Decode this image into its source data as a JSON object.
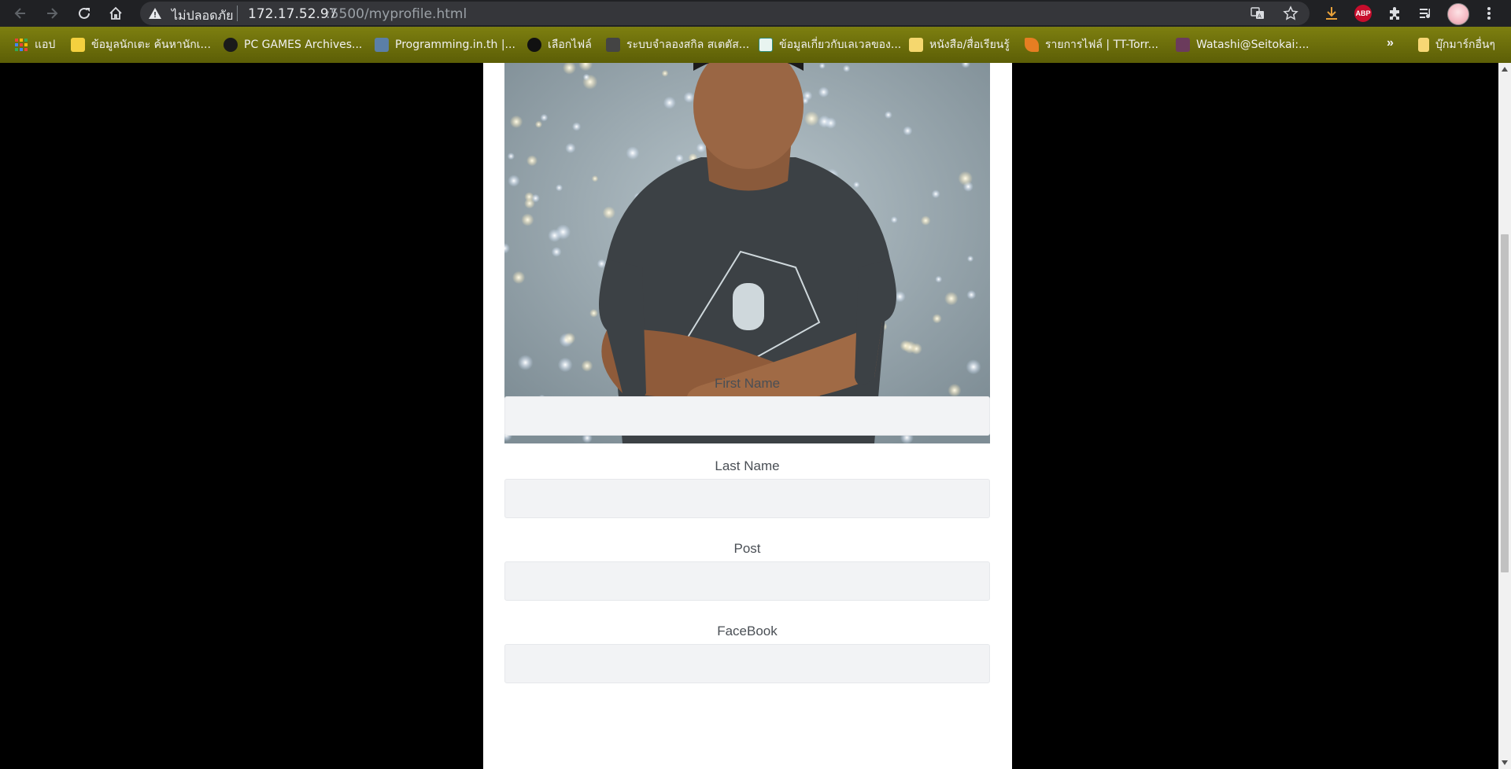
{
  "browser": {
    "security_label": "ไม่ปลอดภัย",
    "url_host": "172.17.52.97",
    "url_path": ":5500/myprofile.html",
    "abp_label": "ABP"
  },
  "bookmarks": {
    "apps_label": "แอป",
    "items": [
      {
        "label": "ข้อมูลนักเตะ ค้นหานักเ..."
      },
      {
        "label": "PC GAMES Archives..."
      },
      {
        "label": "Programming.in.th |..."
      },
      {
        "label": "เลือกไฟล์"
      },
      {
        "label": "ระบบจำลองสกิล สเตตัส..."
      },
      {
        "label": "ข้อมูลเกี่ยวกับเลเวลของ..."
      },
      {
        "label": "หนังสือ/สื่อเรียนรู้"
      },
      {
        "label": "รายการไฟล์ | TT-Torr..."
      },
      {
        "label": "Watashi@Seitokai:..."
      }
    ],
    "more_label": "»",
    "other_label": "บุ๊กมาร์กอื่นๆ"
  },
  "form": {
    "first_name_label": "First Name",
    "first_name_value": "",
    "last_name_label": "Last Name",
    "last_name_value": "",
    "post_label": "Post",
    "post_value": "",
    "facebook_label": "FaceBook",
    "facebook_value": ""
  },
  "colors": {
    "page_bg": "#000000",
    "card_bg": "#ffffff",
    "input_bg": "#f2f3f5",
    "bookmark_bar": "#6d6f0b",
    "toolbar": "#202124"
  }
}
